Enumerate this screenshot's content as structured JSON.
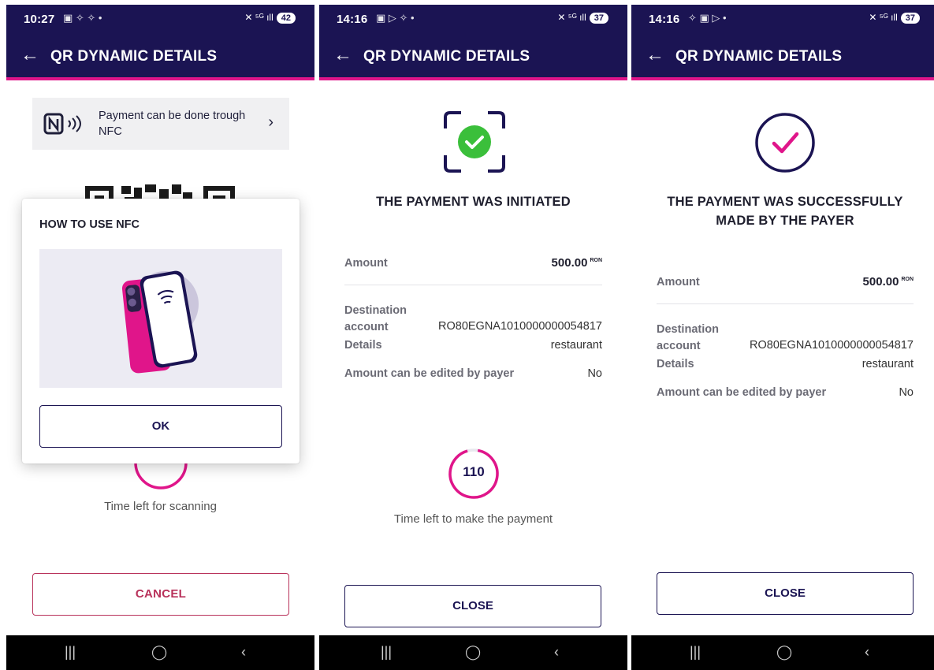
{
  "screens": [
    {
      "status_time": "10:27",
      "battery": "42",
      "title": "QR DYNAMIC DETAILS",
      "nfc_banner": "Payment can be done trough NFC",
      "dialog": {
        "title": "HOW TO USE NFC",
        "ok_label": "OK"
      },
      "timer_caption": "Time left for scanning",
      "cancel_label": "CANCEL"
    },
    {
      "status_time": "14:16",
      "battery": "37",
      "title": "QR DYNAMIC DETAILS",
      "status_title": "THE PAYMENT WAS INITIATED",
      "amount_label": "Amount",
      "amount_value": "500.00",
      "currency": "RON",
      "destination_label_1": "Destination",
      "destination_label_2": "account",
      "destination_value": "RO80EGNA1010000000054817",
      "details_label": "Details",
      "details_value": "restaurant",
      "editable_label": "Amount can be edited by payer",
      "editable_value": "No",
      "timer_value": "110",
      "timer_caption": "Time left to make the payment",
      "close_label": "CLOSE"
    },
    {
      "status_time": "14:16",
      "battery": "37",
      "title": "QR DYNAMIC DETAILS",
      "status_title_line1": "THE PAYMENT WAS SUCCESSFULLY",
      "status_title_line2": "MADE BY THE PAYER",
      "amount_label": "Amount",
      "amount_value": "500.00",
      "currency": "RON",
      "destination_label_1": "Destination",
      "destination_label_2": "account",
      "destination_value": "RO80EGNA1010000000054817",
      "details_label": "Details",
      "details_value": "restaurant",
      "editable_label": "Amount can be edited by payer",
      "editable_value": "No",
      "close_label": "CLOSE"
    }
  ],
  "colors": {
    "header_bg": "#1b1453",
    "accent_pink": "#e0158a",
    "success_green": "#3bbf3b",
    "cancel_red": "#b8315a"
  },
  "icons": [
    "back-arrow-icon",
    "nfc-icon",
    "chevron-right-icon",
    "phone-nfc-illustration",
    "scan-frame-icon",
    "check-circle-icon",
    "recents-icon",
    "home-icon",
    "back-nav-icon"
  ]
}
